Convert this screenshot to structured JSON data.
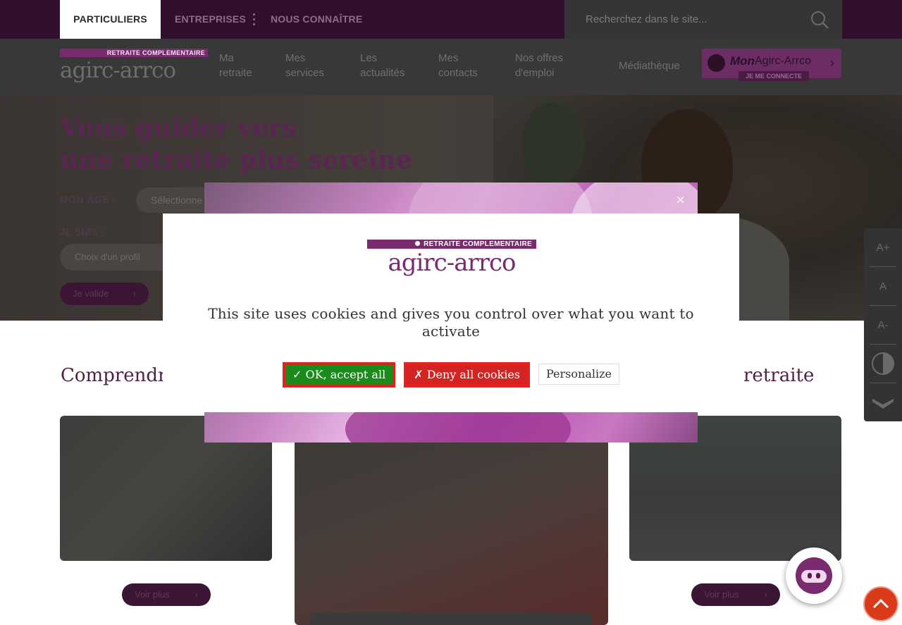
{
  "topbar": {
    "tabs": [
      "PARTICULIERS",
      "ENTREPRISES",
      "NOUS CONNAÎTRE"
    ],
    "search_placeholder": "Recherchez dans le site..."
  },
  "brand": {
    "band_text": "RETRAITE COMPLEMENTAIRE",
    "wordmark": "agirc-arrco"
  },
  "nav": {
    "items": [
      {
        "line1": "Ma",
        "line2": "retraite"
      },
      {
        "line1": "Mes",
        "line2": "services"
      },
      {
        "line1": "Les",
        "line2": "actualités"
      },
      {
        "line1": "Mes",
        "line2": "contacts"
      },
      {
        "line1": "Nos offres",
        "line2": "d'emploi"
      },
      {
        "line1": "Médiathèque",
        "line2": ""
      }
    ],
    "account": {
      "label_italic": "Mon",
      "label": "Agirc-Arrco",
      "sub": "JE ME CONNECTE"
    }
  },
  "hero": {
    "title_line1": "Vous guider vers",
    "title_line2": "une retraite plus sereine",
    "age_label": "MON ÂGE :",
    "age_select": "Sélectionne",
    "profile_label": "JE SUIS :",
    "profile_select": "Choix d'un profil",
    "validate": "Je valide"
  },
  "sections": {
    "left_title": "Comprendre",
    "right_title": "retraite",
    "card_button": "Voir plus"
  },
  "a11y": {
    "increase": "A+",
    "reset": "A",
    "decrease": "A-"
  },
  "cookie": {
    "message": "This site uses cookies and gives you control over what you want to activate",
    "accept": "✓ OK, accept all",
    "deny": "✗ Deny all cookies",
    "personalize": "Personalize"
  },
  "promo": {
    "close": "×"
  },
  "colors": {
    "brand_purple": "#7a2a6e",
    "accept_green": "#1b8c1b",
    "deny_red": "#d42323",
    "scroll_top": "#d93a1a"
  }
}
